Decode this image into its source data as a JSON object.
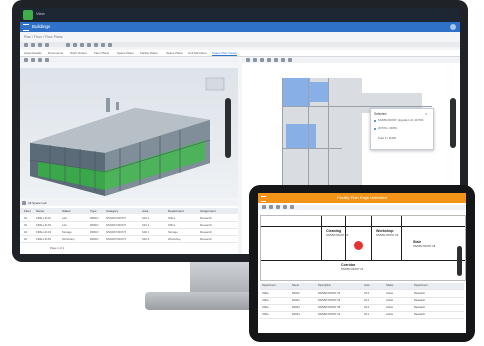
{
  "app": {
    "brand_text": "View",
    "nav_title": "Buildings",
    "breadcrumb": "Plan / Floor / Floor Plans"
  },
  "tabs": [
    {
      "label": "Asset Details"
    },
    {
      "label": "Documents"
    },
    {
      "label": "Work Orders"
    },
    {
      "label": "Floor Plans"
    },
    {
      "label": "Space Plans"
    },
    {
      "label": "Facility Plans"
    },
    {
      "label": "Space Plans"
    },
    {
      "label": "Unit Members"
    },
    {
      "label": "Space Plan Viewer"
    }
  ],
  "popup": {
    "title": "Selected",
    "item1": "NS/MW FRONT, Upgrade to R, 2F/70%",
    "item2": "2F/70% • 4F/8%",
    "item3": "Total: 5 • 4F/8%"
  },
  "table1": {
    "filter_label": "All Space Lab",
    "headers": [
      "Floor",
      "Name",
      "Status",
      "Type",
      "Category",
      "Area",
      "Department",
      "Assignment"
    ],
    "rows": [
      [
        "02",
        "FIRE-LR-02",
        "Lab",
        "RRMO",
        "NS/MW FRONT",
        "S91.1",
        "Office",
        "Research"
      ],
      [
        "02",
        "FIRE-LR-03",
        "Lab",
        "RRMO",
        "NS/MW FRONT",
        "S91.2",
        "Office",
        "Research"
      ],
      [
        "02",
        "FIRE-LR-04",
        "Storage",
        "RRMO",
        "NS/MW FRONT",
        "S92.1",
        "Storage",
        "Research"
      ],
      [
        "02",
        "FIRE-LR-05",
        "Workshop",
        "RRMO",
        "NS/MW FRONT",
        "S92.4",
        "Workshop",
        "Research"
      ]
    ],
    "pagination": "Page 1 of 1"
  },
  "tablet": {
    "title": "Facility Plan Page Unlimited",
    "rooms": [
      {
        "name": "Cleaning",
        "sub": "NS/MW FRONT 04"
      },
      {
        "name": "Workshop",
        "sub": "NS/MW FRONT 06"
      },
      {
        "name": "Stair",
        "sub": "NS/MW FRONT 08"
      },
      {
        "name": "Corridor",
        "sub": "NS/MW FRONT 02"
      }
    ],
    "table": {
      "headers": [
        "Department",
        "Name",
        "Description",
        "Area",
        "Status",
        "Department"
      ],
      "rows": [
        [
          "Office",
          "R2021",
          "NS/MW FRONT 04",
          "34.2",
          "Active",
          "Research"
        ],
        [
          "Office",
          "R2022",
          "NS/MW FRONT 06",
          "34.2",
          "Active",
          "Research"
        ],
        [
          "Office",
          "R2023",
          "NS/MW FRONT 08",
          "34.2",
          "Active",
          "Research"
        ],
        [
          "Office",
          "R2024",
          "NS/MW FRONT 02",
          "34.2",
          "Active",
          "Research"
        ]
      ]
    }
  },
  "colors": {
    "nav": "#2f71c9",
    "tablet_bar": "#f39418",
    "accent_green": "#3fae49"
  }
}
